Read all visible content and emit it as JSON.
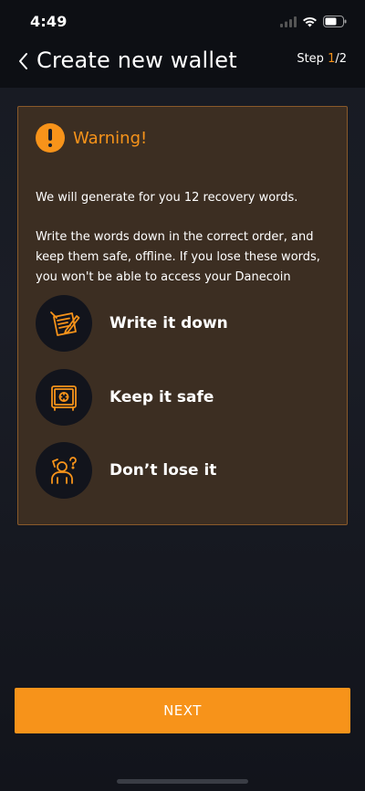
{
  "status_bar": {
    "time": "4:49"
  },
  "nav": {
    "title": "Create new wallet",
    "step_prefix": "Step ",
    "step_current": "1",
    "step_total": "/2"
  },
  "warning": {
    "title": "Warning!",
    "text1": "We will generate for you 12 recovery words.",
    "text2": "Write the words down in the correct order, and keep them safe, offline. If you lose these words, you won't be able to access your Danecoin",
    "tips": [
      {
        "label": "Write it down",
        "icon": "write-icon"
      },
      {
        "label": "Keep it safe",
        "icon": "safe-icon"
      },
      {
        "label": "Don’t lose it",
        "icon": "confused-person-icon"
      }
    ]
  },
  "next_button": {
    "label": "NEXT"
  },
  "colors": {
    "accent": "#f7931a",
    "card": "#3c2e22",
    "card_border": "#8a5a2a",
    "background": "#171a22"
  }
}
